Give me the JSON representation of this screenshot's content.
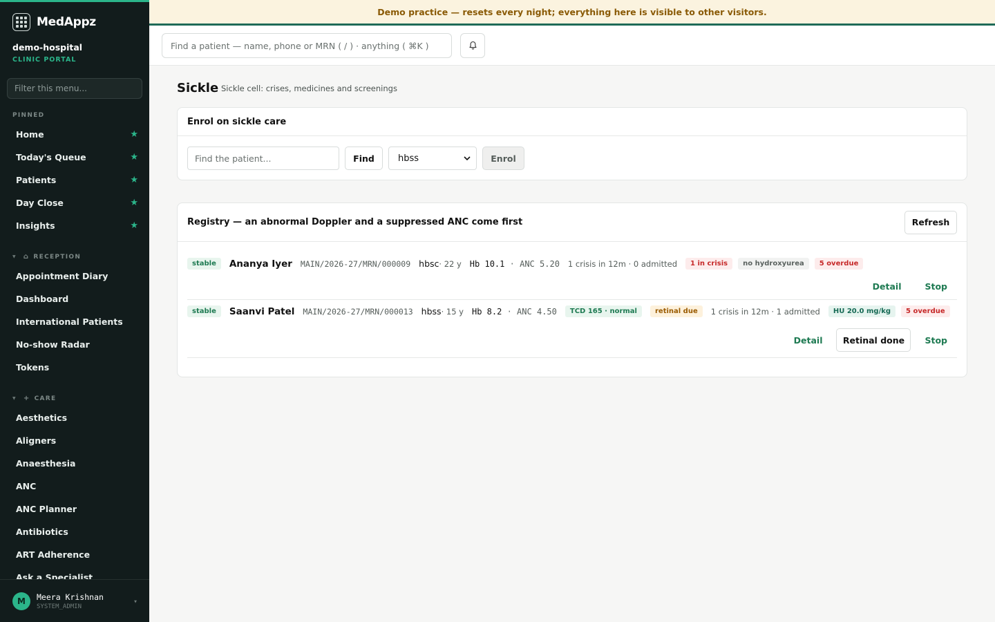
{
  "brand": {
    "name": "MedAppz"
  },
  "org": {
    "name": "demo-hospital",
    "subtitle": "CLINIC PORTAL"
  },
  "sidebar": {
    "filter_placeholder": "Filter this menu...",
    "pinned_label": "PINNED",
    "pinned": [
      {
        "label": "Home",
        "icon": "star-icon"
      },
      {
        "label": "Today's Queue",
        "icon": "star-icon"
      },
      {
        "label": "Patients",
        "icon": "star-icon"
      },
      {
        "label": "Day Close",
        "icon": "star-icon"
      },
      {
        "label": "Insights",
        "icon": "star-icon"
      }
    ],
    "reception_label": "RECEPTION",
    "reception": [
      {
        "label": "Appointment Diary"
      },
      {
        "label": "Dashboard"
      },
      {
        "label": "International Patients"
      },
      {
        "label": "No-show Radar"
      },
      {
        "label": "Tokens"
      }
    ],
    "care_label": "CARE",
    "care": [
      {
        "label": "Aesthetics"
      },
      {
        "label": "Aligners"
      },
      {
        "label": "Anaesthesia"
      },
      {
        "label": "ANC"
      },
      {
        "label": "ANC Planner"
      },
      {
        "label": "Antibiotics"
      },
      {
        "label": "ART Adherence"
      },
      {
        "label": "Ask a Specialist"
      }
    ]
  },
  "user": {
    "initial": "M",
    "name": "Meera Krishnan",
    "role": "SYSTEM_ADMIN"
  },
  "banner": {
    "text": "Demo practice — resets every night; everything here is visible to other visitors."
  },
  "topbar": {
    "search_placeholder": "Find a patient — name, phone or MRN ( / ) · anything ( ⌘K )"
  },
  "page": {
    "title": "Sickle",
    "subtitle": "Sickle cell: crises, medicines and screenings"
  },
  "enrol": {
    "title": "Enrol on sickle care",
    "search_placeholder": "Find the patient...",
    "find_label": "Find",
    "genotype_selected": "hbss",
    "enrol_label": "Enrol"
  },
  "registry": {
    "title": "Registry — an abnormal Doppler and a suppressed ANC come first",
    "refresh_label": "Refresh",
    "rows": [
      {
        "status": "stable",
        "name": "Ananya Iyer",
        "mrn": "MAIN/2026-27/MRN/000009",
        "genotype": "hbsc",
        "age": " · 22 y",
        "hb_label": "Hb",
        "hb": "10.1",
        "anc_label": "ANC",
        "anc": "5.20",
        "crisis": "1 crisis in 12m · 0 admitted",
        "tags": [
          "1 in crisis",
          "no hydroxyurea",
          "5 overdue"
        ],
        "actions": [
          "Detail",
          "Stop"
        ]
      },
      {
        "status": "stable",
        "name": "Saanvi Patel",
        "mrn": "MAIN/2026-27/MRN/000013",
        "genotype": "hbss",
        "age": " · 15 y",
        "hb_label": "Hb",
        "hb": "8.2",
        "anc_label": "ANC",
        "anc": "4.50",
        "tcd": "TCD 165 · normal",
        "retinal": "retinal due",
        "crisis": "1 crisis in 12m · 1 admitted",
        "hu": "HU 20.0 mg/kg",
        "overdue": "5 overdue",
        "actions": [
          "Detail",
          "Retinal done",
          "Stop"
        ]
      }
    ]
  },
  "colors": {
    "accent": "#2bb58a",
    "sidebar_bg": "#121c1c",
    "banner_bg": "#fbf3df",
    "banner_text": "#8a5a06",
    "link": "#1e7a52",
    "danger": "#c62828"
  }
}
